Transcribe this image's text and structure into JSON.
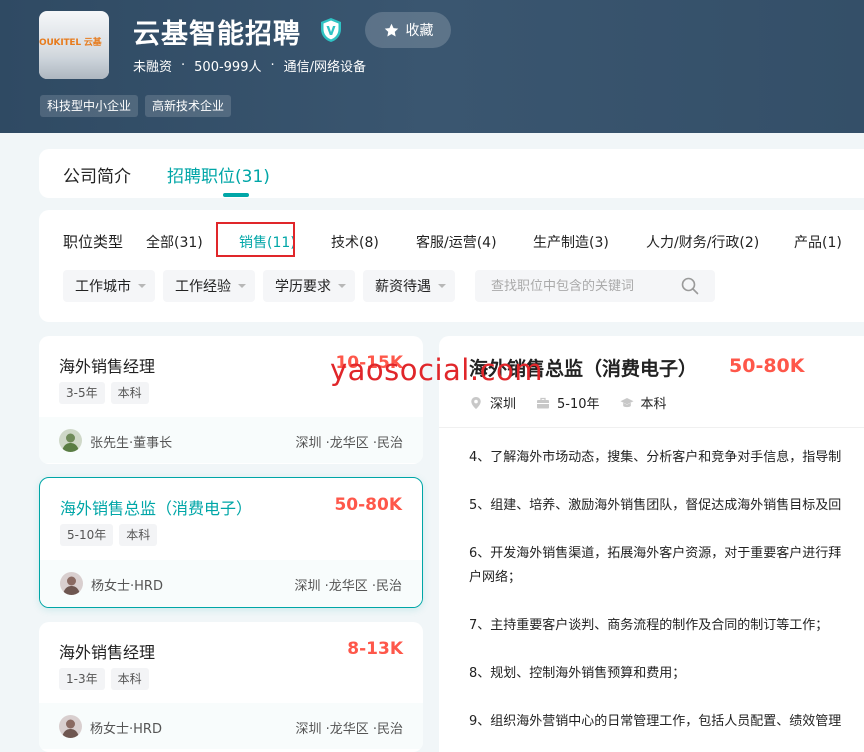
{
  "company": {
    "name": "云基智能招聘",
    "logo_text": "OUKITEL 云基",
    "funding": "未融资",
    "size": "500-999人",
    "industry": "通信/网络设备",
    "tags": [
      "科技型中小企业",
      "高新技术企业"
    ],
    "favorite_label": "收藏"
  },
  "tabs": {
    "intro": "公司简介",
    "jobs": "招聘职位(31)"
  },
  "filters": {
    "type_label": "职位类型",
    "categories": [
      "全部(31)",
      "销售(11)",
      "技术(8)",
      "客服/运营(4)",
      "生产制造(3)",
      "人力/财务/行政(2)",
      "产品(1)"
    ],
    "dropdowns": [
      "工作城市",
      "工作经验",
      "学历要求",
      "薪资待遇"
    ],
    "search_placeholder": "查找职位中包含的关键词"
  },
  "jobs": [
    {
      "title": "海外销售经理",
      "salary": "10-15K",
      "exp": "3-5年",
      "edu": "本科",
      "boss": "张先生·董事长",
      "location": "深圳 ·龙华区 ·民治"
    },
    {
      "title": "海外销售总监（消费电子）",
      "salary": "50-80K",
      "exp": "5-10年",
      "edu": "本科",
      "boss": "杨女士·HRD",
      "location": "深圳 ·龙华区 ·民治"
    },
    {
      "title": "海外销售经理",
      "salary": "8-13K",
      "exp": "1-3年",
      "edu": "本科",
      "boss": "杨女士·HRD",
      "location": "深圳 ·龙华区 ·民治"
    }
  ],
  "detail": {
    "title": "海外销售总监（消费电子）",
    "salary": "50-80K",
    "city": "深圳",
    "exp": "5-10年",
    "edu": "本科",
    "lines": [
      "4、了解海外市场动态，搜集、分析客户和竞争对手信息，指导制",
      "5、组建、培养、激励海外销售团队，督促达成海外销售目标及回",
      "6、开发海外销售渠道，拓展海外客户资源，对于重要客户进行拜",
      "户网络；",
      "7、主持重要客户谈判、商务流程的制作及合同的制订等工作；",
      "8、规划、控制海外销售预算和费用；",
      "9、组织海外营销中心的日常管理工作，包括人员配置、绩效管理"
    ]
  },
  "watermark": "yaosocial.com",
  "colors": {
    "accent": "#00a6a7",
    "salary": "#fe574a",
    "header": "#344f68",
    "highlight_box": "#e0262a"
  }
}
